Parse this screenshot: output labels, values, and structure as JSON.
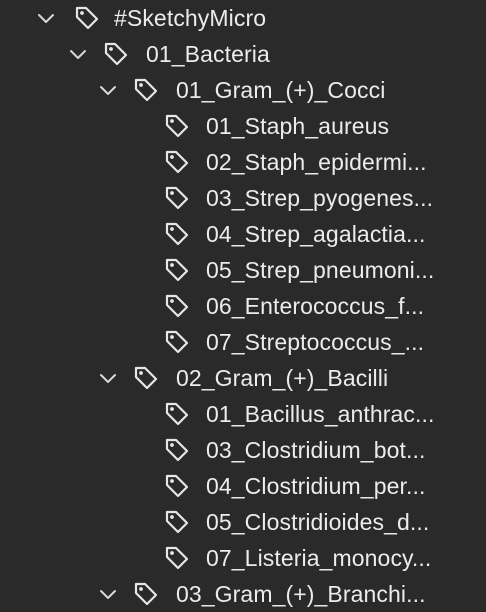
{
  "tree": {
    "rows": [
      {
        "label": "#SketchyMicro",
        "expanded": true,
        "icon": "tag-icon"
      },
      {
        "label": "01_Bacteria",
        "expanded": true,
        "icon": "tag-icon"
      },
      {
        "label": "01_Gram_(+)_Cocci",
        "expanded": true,
        "icon": "tag-icon"
      },
      {
        "label": "01_Staph_aureus",
        "icon": "tag-icon"
      },
      {
        "label": "02_Staph_epidermi...",
        "icon": "tag-icon"
      },
      {
        "label": "03_Strep_pyogenes...",
        "icon": "tag-icon"
      },
      {
        "label": "04_Strep_agalactia...",
        "icon": "tag-icon"
      },
      {
        "label": "05_Strep_pneumoni...",
        "icon": "tag-icon"
      },
      {
        "label": "06_Enterococcus_f...",
        "icon": "tag-icon"
      },
      {
        "label": "07_Streptococcus_...",
        "icon": "tag-icon"
      },
      {
        "label": "02_Gram_(+)_Bacilli",
        "expanded": true,
        "icon": "tag-icon"
      },
      {
        "label": "01_Bacillus_anthrac...",
        "icon": "tag-icon"
      },
      {
        "label": "03_Clostridium_bot...",
        "icon": "tag-icon"
      },
      {
        "label": "04_Clostridium_per...",
        "icon": "tag-icon"
      },
      {
        "label": "05_Clostridioides_d...",
        "icon": "tag-icon"
      },
      {
        "label": "07_Listeria_monocy...",
        "icon": "tag-icon"
      },
      {
        "label": "03_Gram_(+)_Branchi...",
        "expanded": true,
        "icon": "tag-icon"
      }
    ]
  }
}
